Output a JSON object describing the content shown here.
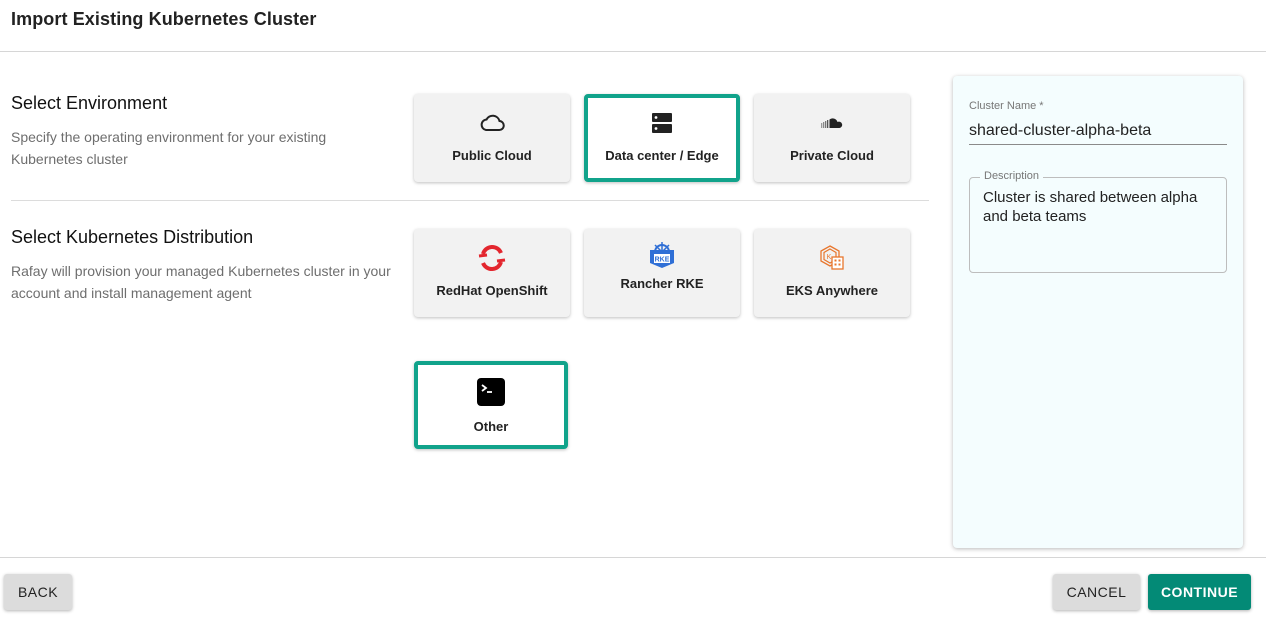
{
  "header": {
    "title": "Import Existing Kubernetes Cluster"
  },
  "environment": {
    "title": "Select Environment",
    "description": "Specify the operating environment for your existing Kubernetes cluster",
    "options": [
      {
        "label": "Public Cloud",
        "icon": "cloud-outline-icon",
        "selected": false
      },
      {
        "label": "Data center / Edge",
        "icon": "server-icon",
        "selected": true
      },
      {
        "label": "Private Cloud",
        "icon": "soundcloud-cloud-icon",
        "selected": false
      }
    ]
  },
  "distribution": {
    "title": "Select Kubernetes Distribution",
    "description": "Rafay will provision your managed Kubernetes cluster in your account and install management agent",
    "options": [
      {
        "label": "RedHat OpenShift",
        "icon": "openshift-logo-icon",
        "selected": false
      },
      {
        "label": "Rancher RKE",
        "icon": "rancher-rke-logo-icon",
        "selected": false
      },
      {
        "label": "EKS Anywhere",
        "icon": "eks-anywhere-logo-icon",
        "selected": false
      },
      {
        "label": "Other",
        "icon": "terminal-icon",
        "selected": true
      }
    ]
  },
  "form": {
    "cluster_name_label": "Cluster Name *",
    "cluster_name_value": "shared-cluster-alpha-beta",
    "description_label": "Description",
    "description_value": "Cluster is shared between alpha and beta teams"
  },
  "footer": {
    "back_label": "BACK",
    "cancel_label": "CANCEL",
    "continue_label": "CONTINUE"
  },
  "colors": {
    "accent": "#11a38b",
    "primary_button": "#038a76",
    "panel_background": "#f4fdfe",
    "openshift_red": "#e3262e",
    "rke_blue": "#2f6fd6",
    "eks_orange": "#e8762d"
  }
}
